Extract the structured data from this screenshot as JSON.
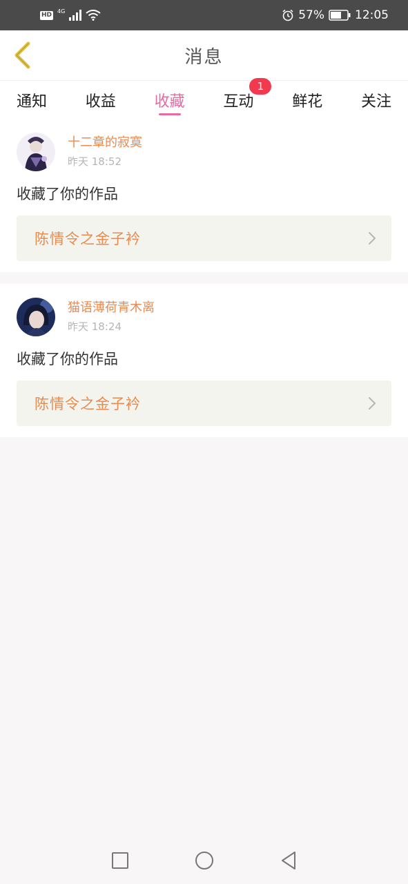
{
  "status_bar": {
    "hd_label": "HD",
    "network_label": "4G",
    "battery_percent": "57%",
    "time": "12:05",
    "icons": [
      "hd-icon",
      "signal-icon",
      "wifi-icon",
      "alarm-icon",
      "battery-icon"
    ]
  },
  "header": {
    "title": "消息",
    "back_icon": "chevron-left-icon"
  },
  "tabs": [
    {
      "label": "通知",
      "active": false
    },
    {
      "label": "收益",
      "active": false
    },
    {
      "label": "收藏",
      "active": true
    },
    {
      "label": "互动",
      "active": false,
      "badge": "1"
    },
    {
      "label": "鲜花",
      "active": false
    },
    {
      "label": "关注",
      "active": false
    }
  ],
  "messages": [
    {
      "user": "十二章的寂寞",
      "time": "昨天 18:52",
      "text": "收藏了你的作品",
      "work": "陈情令之金子衿"
    },
    {
      "user": "猫语薄荷青木离",
      "time": "昨天 18:24",
      "text": "收藏了你的作品",
      "work": "陈情令之金子衿"
    }
  ],
  "colors": {
    "accent_pink": "#e56aa2",
    "accent_orange": "#e88b50",
    "badge_red": "#f23a4e",
    "back_icon_gold": "#e0c040"
  },
  "nav_bar": {
    "icons": [
      "recent-apps-icon",
      "home-icon",
      "back-triangle-icon"
    ]
  }
}
